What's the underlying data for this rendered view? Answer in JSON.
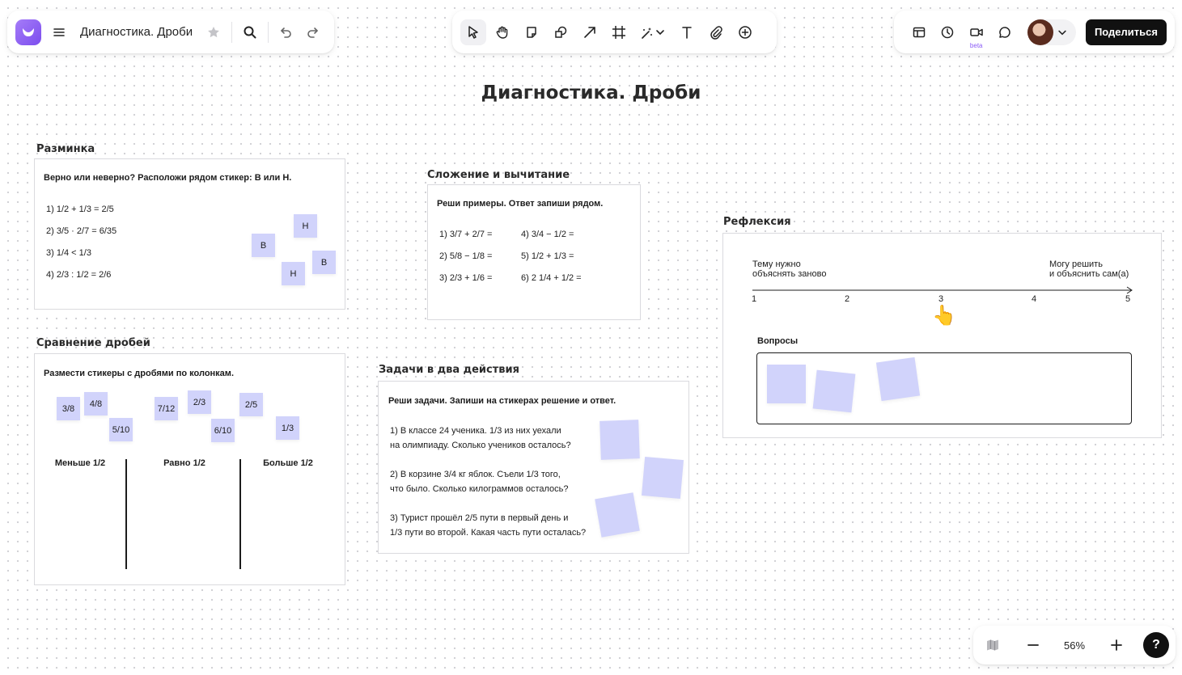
{
  "toolbar_left": {
    "title": "Диагностика. Дроби",
    "icons": [
      "app-logo",
      "menu-icon",
      "star-icon",
      "search-icon",
      "undo-icon",
      "redo-icon"
    ]
  },
  "toolbar_center": {
    "tools": [
      "select-icon",
      "hand-icon",
      "sticky-note-icon",
      "shapes-icon",
      "arrow-icon",
      "frame-icon",
      "magic-icon",
      "text-icon",
      "attachment-icon",
      "add-icon"
    ]
  },
  "toolbar_right": {
    "beta_label": "beta",
    "share_label": "Поделиться",
    "icons": [
      "layout-icon",
      "clock-icon",
      "video-icon",
      "comment-icon",
      "avatar",
      "chevron-down-icon"
    ]
  },
  "board": {
    "title": "Диагностика. Дроби"
  },
  "warmup": {
    "title": "Разминка",
    "instruction": "Верно или неверно? Расположи рядом стикер: В или Н.",
    "items": [
      "1)  1/2 + 1/3 = 2/5",
      "2)  3/5 · 2/7 = 6/35",
      "3)  1/4 < 1/3",
      "4)  2/3 : 1/2 = 2/6"
    ],
    "stickers": [
      "Н",
      "В",
      "В",
      "Н"
    ]
  },
  "addsub": {
    "title": "Сложение и вычитание",
    "instruction": "Реши примеры. Ответ запиши рядом.",
    "left": [
      "1)  3/7 + 2/7 =",
      "2)  5/8 − 1/8 =",
      "3)  2/3 + 1/6 ="
    ],
    "right": [
      "4)  3/4 − 1/2 =",
      "5)  1/2 + 1/3 =",
      "6)  2 1/4 + 1/2 ="
    ]
  },
  "reflection": {
    "title": "Рефлексия",
    "left_label_1": "Тему нужно",
    "left_label_2": "объяснять заново",
    "right_label_1": "Могу решить",
    "right_label_2": "и объяснить сам(а)",
    "ticks": [
      "1",
      "2",
      "3",
      "4",
      "5"
    ],
    "pointer_emoji": "👆",
    "pointer_value": 3,
    "questions_label": "Вопросы"
  },
  "compare": {
    "title": "Сравнение дробей",
    "instruction": "Размести стикеры с дробями по колонкам.",
    "stickers": [
      "3/8",
      "4/8",
      "5/10",
      "7/12",
      "2/3",
      "6/10",
      "2/5",
      "1/3"
    ],
    "columns": [
      "Меньше 1/2",
      "Равно 1/2",
      "Больше 1/2"
    ]
  },
  "tasks": {
    "title": "Задачи в два действия",
    "instruction": "Реши задачи. Запиши на стикерах решение и ответ.",
    "lines": [
      "1) В классе 24 ученика. 1/3 из них уехали",
      "на олимпиаду. Сколько учеников осталось?",
      "2) В корзине 3/4 кг яблок. Съели 1/3 того,",
      "что было. Сколько килограммов осталось?",
      "3) Турист прошёл 2/5 пути в первый день и",
      "1/3 пути во второй. Какая часть пути осталась?"
    ]
  },
  "zoom": {
    "level": "56%",
    "help": "?"
  },
  "colors": {
    "sticker": "#d1d3fb",
    "accent": "#8b5cf6",
    "share_bg": "#111111"
  }
}
